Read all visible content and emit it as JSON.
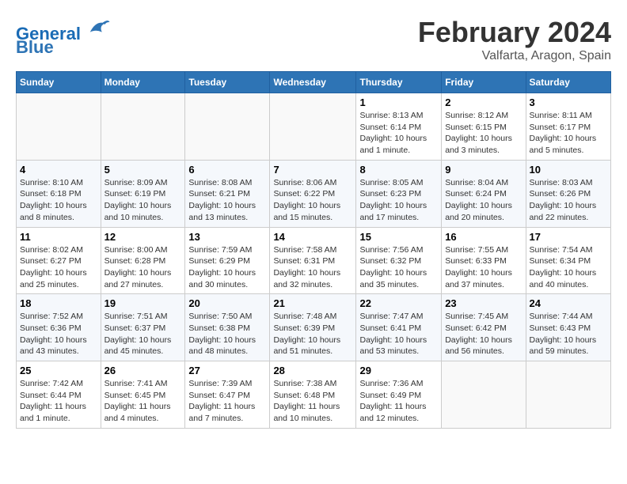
{
  "header": {
    "logo_line1": "General",
    "logo_line2": "Blue",
    "month_title": "February 2024",
    "location": "Valfarta, Aragon, Spain"
  },
  "weekdays": [
    "Sunday",
    "Monday",
    "Tuesday",
    "Wednesday",
    "Thursday",
    "Friday",
    "Saturday"
  ],
  "weeks": [
    [
      {
        "day": "",
        "info": ""
      },
      {
        "day": "",
        "info": ""
      },
      {
        "day": "",
        "info": ""
      },
      {
        "day": "",
        "info": ""
      },
      {
        "day": "1",
        "info": "Sunrise: 8:13 AM\nSunset: 6:14 PM\nDaylight: 10 hours\nand 1 minute."
      },
      {
        "day": "2",
        "info": "Sunrise: 8:12 AM\nSunset: 6:15 PM\nDaylight: 10 hours\nand 3 minutes."
      },
      {
        "day": "3",
        "info": "Sunrise: 8:11 AM\nSunset: 6:17 PM\nDaylight: 10 hours\nand 5 minutes."
      }
    ],
    [
      {
        "day": "4",
        "info": "Sunrise: 8:10 AM\nSunset: 6:18 PM\nDaylight: 10 hours\nand 8 minutes."
      },
      {
        "day": "5",
        "info": "Sunrise: 8:09 AM\nSunset: 6:19 PM\nDaylight: 10 hours\nand 10 minutes."
      },
      {
        "day": "6",
        "info": "Sunrise: 8:08 AM\nSunset: 6:21 PM\nDaylight: 10 hours\nand 13 minutes."
      },
      {
        "day": "7",
        "info": "Sunrise: 8:06 AM\nSunset: 6:22 PM\nDaylight: 10 hours\nand 15 minutes."
      },
      {
        "day": "8",
        "info": "Sunrise: 8:05 AM\nSunset: 6:23 PM\nDaylight: 10 hours\nand 17 minutes."
      },
      {
        "day": "9",
        "info": "Sunrise: 8:04 AM\nSunset: 6:24 PM\nDaylight: 10 hours\nand 20 minutes."
      },
      {
        "day": "10",
        "info": "Sunrise: 8:03 AM\nSunset: 6:26 PM\nDaylight: 10 hours\nand 22 minutes."
      }
    ],
    [
      {
        "day": "11",
        "info": "Sunrise: 8:02 AM\nSunset: 6:27 PM\nDaylight: 10 hours\nand 25 minutes."
      },
      {
        "day": "12",
        "info": "Sunrise: 8:00 AM\nSunset: 6:28 PM\nDaylight: 10 hours\nand 27 minutes."
      },
      {
        "day": "13",
        "info": "Sunrise: 7:59 AM\nSunset: 6:29 PM\nDaylight: 10 hours\nand 30 minutes."
      },
      {
        "day": "14",
        "info": "Sunrise: 7:58 AM\nSunset: 6:31 PM\nDaylight: 10 hours\nand 32 minutes."
      },
      {
        "day": "15",
        "info": "Sunrise: 7:56 AM\nSunset: 6:32 PM\nDaylight: 10 hours\nand 35 minutes."
      },
      {
        "day": "16",
        "info": "Sunrise: 7:55 AM\nSunset: 6:33 PM\nDaylight: 10 hours\nand 37 minutes."
      },
      {
        "day": "17",
        "info": "Sunrise: 7:54 AM\nSunset: 6:34 PM\nDaylight: 10 hours\nand 40 minutes."
      }
    ],
    [
      {
        "day": "18",
        "info": "Sunrise: 7:52 AM\nSunset: 6:36 PM\nDaylight: 10 hours\nand 43 minutes."
      },
      {
        "day": "19",
        "info": "Sunrise: 7:51 AM\nSunset: 6:37 PM\nDaylight: 10 hours\nand 45 minutes."
      },
      {
        "day": "20",
        "info": "Sunrise: 7:50 AM\nSunset: 6:38 PM\nDaylight: 10 hours\nand 48 minutes."
      },
      {
        "day": "21",
        "info": "Sunrise: 7:48 AM\nSunset: 6:39 PM\nDaylight: 10 hours\nand 51 minutes."
      },
      {
        "day": "22",
        "info": "Sunrise: 7:47 AM\nSunset: 6:41 PM\nDaylight: 10 hours\nand 53 minutes."
      },
      {
        "day": "23",
        "info": "Sunrise: 7:45 AM\nSunset: 6:42 PM\nDaylight: 10 hours\nand 56 minutes."
      },
      {
        "day": "24",
        "info": "Sunrise: 7:44 AM\nSunset: 6:43 PM\nDaylight: 10 hours\nand 59 minutes."
      }
    ],
    [
      {
        "day": "25",
        "info": "Sunrise: 7:42 AM\nSunset: 6:44 PM\nDaylight: 11 hours\nand 1 minute."
      },
      {
        "day": "26",
        "info": "Sunrise: 7:41 AM\nSunset: 6:45 PM\nDaylight: 11 hours\nand 4 minutes."
      },
      {
        "day": "27",
        "info": "Sunrise: 7:39 AM\nSunset: 6:47 PM\nDaylight: 11 hours\nand 7 minutes."
      },
      {
        "day": "28",
        "info": "Sunrise: 7:38 AM\nSunset: 6:48 PM\nDaylight: 11 hours\nand 10 minutes."
      },
      {
        "day": "29",
        "info": "Sunrise: 7:36 AM\nSunset: 6:49 PM\nDaylight: 11 hours\nand 12 minutes."
      },
      {
        "day": "",
        "info": ""
      },
      {
        "day": "",
        "info": ""
      }
    ]
  ]
}
